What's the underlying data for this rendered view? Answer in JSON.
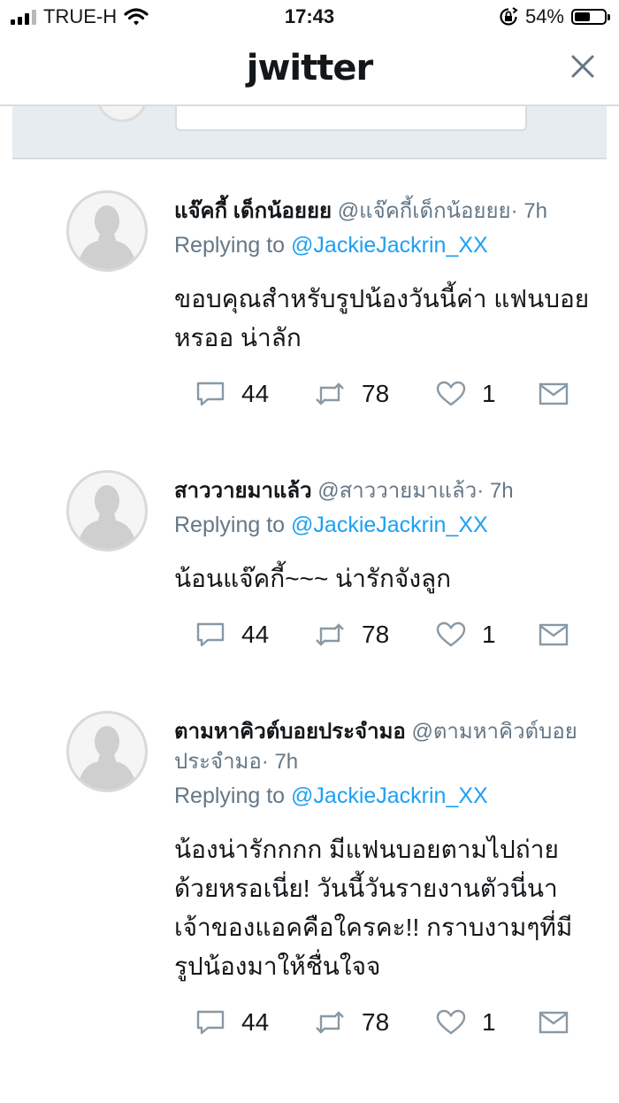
{
  "status_bar": {
    "carrier": "TRUE-H",
    "time": "17:43",
    "battery_percent": "54%",
    "battery_level": 0.54
  },
  "header": {
    "logo": "jwitter",
    "close_icon": "close-icon"
  },
  "replies": [
    {
      "name": "แจ๊คกี้ เด็กน้อยยย",
      "handle": "@แจ๊คกี้เด็กน้อยยย",
      "time": "· 7h",
      "replying_prefix": "Replying to",
      "replying_to": "@JackieJackrin_XX",
      "text": "ขอบคุณสำหรับรูปน้องวันนี้ค่า แฟนบอยหรออ น่าลัก",
      "replies": "44",
      "retweets": "78",
      "likes": "1"
    },
    {
      "name": "สาววายมาแล้ว",
      "handle": "@สาววายมาแล้ว",
      "time": "· 7h",
      "replying_prefix": "Replying to",
      "replying_to": "@JackieJackrin_XX",
      "text": "น้อนแจ๊คกี้~~~ น่ารักจังลูก",
      "replies": "44",
      "retweets": "78",
      "likes": "1"
    },
    {
      "name": "ตามหาคิวต์บอยประจำมอ",
      "handle": "@ตามหาคิวต์บอยประจำมอ",
      "time": "· 7h",
      "replying_prefix": "Replying to",
      "replying_to": "@JackieJackrin_XX",
      "text": "น้องน่ารักกกก มีแฟนบอยตามไปถ่ายด้วยหรอเนี่ย! วันนี้วันรายงานตัวนี่นา เจ้าของแอคคือใครคะ!! กราบงามๆที่มีรูปน้องมาให้ชื่นใจจ",
      "replies": "44",
      "retweets": "78",
      "likes": "1"
    }
  ]
}
